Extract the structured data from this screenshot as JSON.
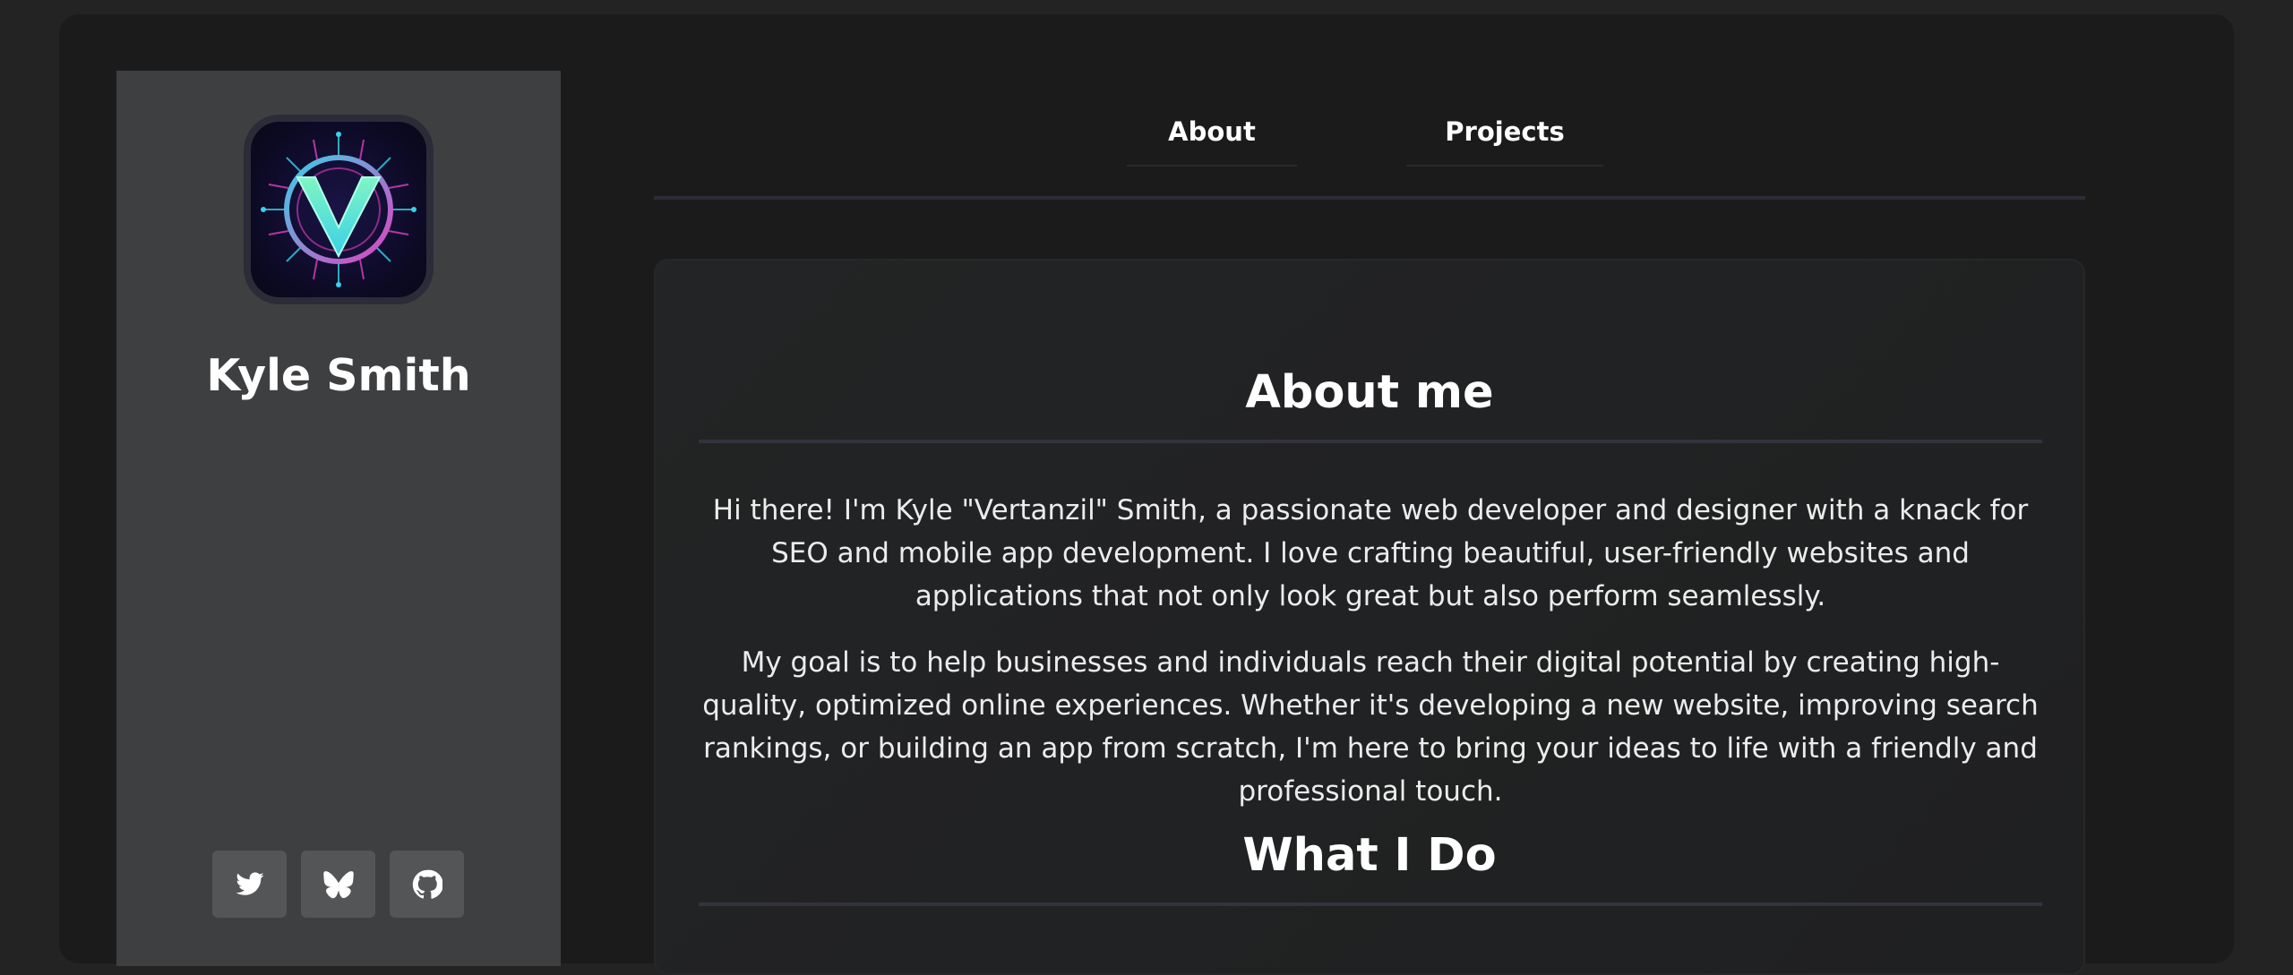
{
  "profile": {
    "name": "Kyle Smith",
    "logo_icon": "vertanzil-v-logo"
  },
  "socials": [
    {
      "icon": "twitter-icon"
    },
    {
      "icon": "butterfly-icon"
    },
    {
      "icon": "github-icon"
    }
  ],
  "nav": {
    "about": "About",
    "projects": "Projects"
  },
  "about": {
    "title": "About me",
    "paragraph_1": "Hi there! I'm Kyle \"Vertanzil\" Smith, a passionate web developer and designer with a knack for SEO and mobile app development. I love crafting beautiful, user-friendly websites and applications that not only look great but also perform seamlessly.",
    "paragraph_2": "My goal is to help businesses and individuals reach their digital potential by creating high-quality, optimized online experiences. Whether it's developing a new website, improving search rankings, or building an app from scratch, I'm here to bring your ideas to life with a friendly and professional touch."
  },
  "what_i_do": {
    "title": "What I Do"
  },
  "colors": {
    "background": "#232324",
    "panel": "#1b1b1c",
    "sidebar": "#3e3f41",
    "accent_cyan": "#5ef2d8",
    "accent_pink": "#e040c0"
  }
}
